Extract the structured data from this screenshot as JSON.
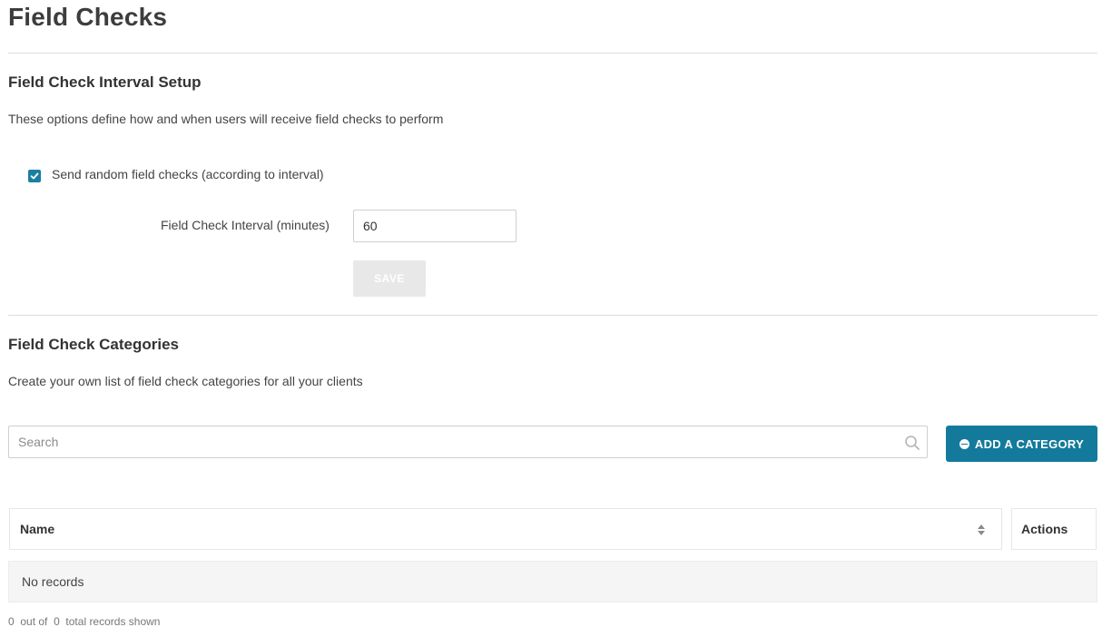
{
  "page": {
    "title": "Field Checks"
  },
  "interval_setup": {
    "title": "Field Check Interval Setup",
    "description": "These options define how and when users will receive field checks to perform",
    "random_checks_label": "Send random field checks (according to interval)",
    "random_checks_checked": true,
    "interval_label": "Field Check Interval (minutes)",
    "interval_value": "60",
    "save_label": "SAVE"
  },
  "categories": {
    "title": "Field Check Categories",
    "description": "Create your own list of field check categories for all your clients",
    "search_placeholder": "Search",
    "add_label": "ADD A CATEGORY",
    "table": {
      "columns": [
        "Name",
        "Actions"
      ],
      "empty_text": "No records"
    },
    "footer": {
      "shown": "0",
      "out_of_label": "out of",
      "total": "0",
      "suffix_label": "total records shown"
    }
  },
  "colors": {
    "accent": "#137a9c",
    "checkbox": "#1a7fa1",
    "disabled_button": "#e8e8e8"
  },
  "icons": [
    "check-icon",
    "search-icon",
    "plus-circle-icon",
    "sort-icon"
  ]
}
